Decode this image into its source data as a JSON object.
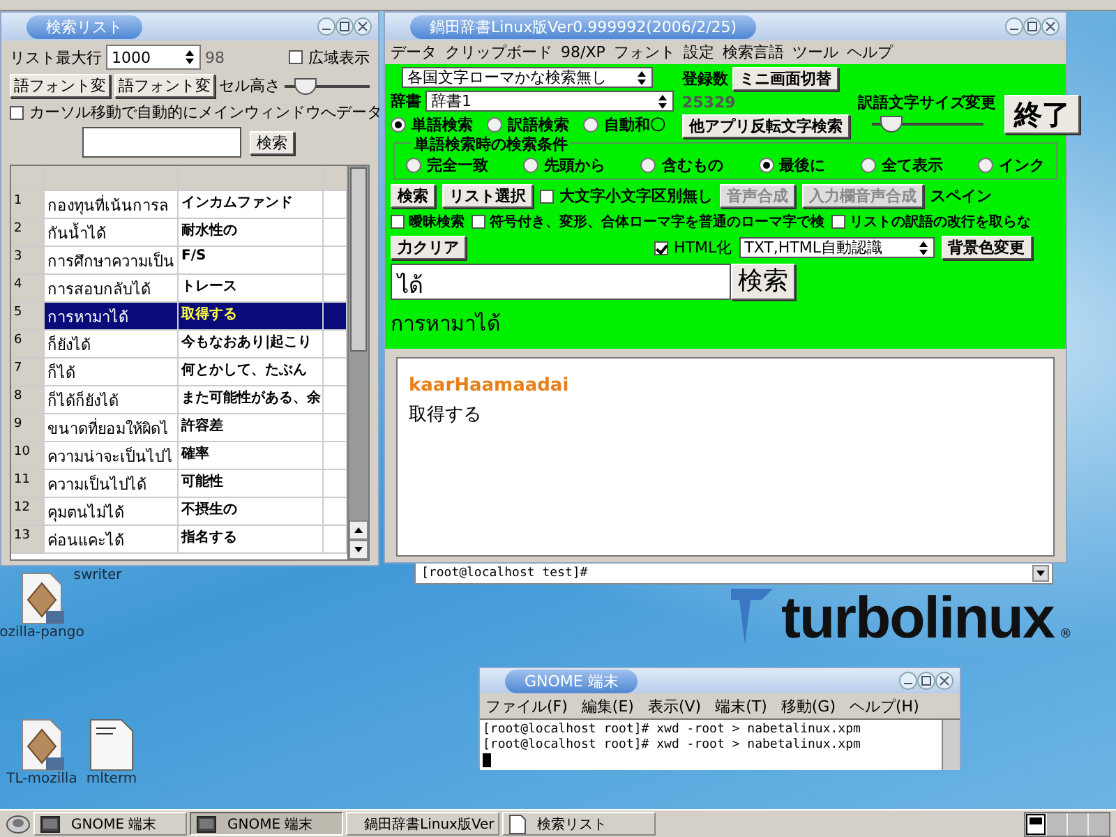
{
  "list_window": {
    "title": "検索リスト",
    "max_rows": {
      "label": "リスト最大行",
      "value": "1000"
    },
    "row_count": "98",
    "wide_display": {
      "label": "広域表示",
      "checked": false
    },
    "font_buttons": [
      "語フォント変",
      "語フォント変"
    ],
    "cell_height": {
      "label": "セル高さ",
      "level": 0.12
    },
    "auto_send": {
      "label": "カーソル移動で自動的にメインウィンドウへデータ",
      "checked": false
    },
    "search_button": "検索",
    "rows": [
      {
        "number": "1",
        "thai": "กองทุนที่เน้นการล",
        "japanese": "インカムファンド",
        "selected": false
      },
      {
        "number": "2",
        "thai": "กันน้ำได้",
        "japanese": "耐水性の",
        "selected": false
      },
      {
        "number": "3",
        "thai": "การศึกษาความเป็น",
        "japanese": "F/S",
        "selected": false
      },
      {
        "number": "4",
        "thai": "การสอบกลับได้",
        "japanese": "トレース",
        "selected": false
      },
      {
        "number": "5",
        "thai": "การหามาได้",
        "japanese": "取得する",
        "selected": true
      },
      {
        "number": "6",
        "thai": "ก็ยังได้",
        "japanese": "今もなおあり|起こり",
        "selected": false
      },
      {
        "number": "7",
        "thai": "ก็ได้",
        "japanese": "何とかして、たぶん",
        "selected": false
      },
      {
        "number": "8",
        "thai": "ก็ได้ก็ยังได้",
        "japanese": "また可能性がある、余",
        "selected": false
      },
      {
        "number": "9",
        "thai": "ขนาดที่ยอมให้ผิดไ",
        "japanese": "許容差",
        "selected": false
      },
      {
        "number": "10",
        "thai": "ความน่าจะเป็นไปไ",
        "japanese": "確率",
        "selected": false
      },
      {
        "number": "11",
        "thai": "ความเป็นไปได้",
        "japanese": "可能性",
        "selected": false
      },
      {
        "number": "12",
        "thai": "คุมตนไม่ได้",
        "japanese": "不摂生の",
        "selected": false
      },
      {
        "number": "13",
        "thai": "ค่อนแคะได้",
        "japanese": "指名する",
        "selected": false
      }
    ]
  },
  "main_window": {
    "title": "鍋田辞書Linux版Ver0.999992(2006/2/25)",
    "menu": [
      "データ",
      "クリップボード",
      "98/XP",
      "フォント",
      "設定",
      "検索言語",
      "ツール",
      "ヘルプ"
    ],
    "romaji_select": "各国文字ローマかな検索無し",
    "dictionary": {
      "label": "辞書",
      "value": "辞書1"
    },
    "registered": {
      "label": "登録数",
      "count": "25329"
    },
    "mini_button": "ミニ画面切替",
    "reverse_button": "他アプリ反転文字検索",
    "font_size": {
      "label": "訳語文字サイズ変更",
      "level": 0.08
    },
    "quit_button": "終了",
    "search_modes": [
      {
        "label": "単語検索",
        "selected": true
      },
      {
        "label": "訳語検索",
        "selected": false
      },
      {
        "label": "自動和〇",
        "selected": false
      }
    ],
    "conditions": {
      "title": "単語検索時の検索条件",
      "options": [
        {
          "label": "完全一致",
          "selected": false
        },
        {
          "label": "先頭から",
          "selected": false
        },
        {
          "label": "含むもの",
          "selected": false
        },
        {
          "label": "最後に",
          "selected": true
        },
        {
          "label": "全て表示",
          "selected": false
        },
        {
          "label": "インク",
          "selected": false
        }
      ]
    },
    "action_row": [
      {
        "kind": "button",
        "label": "検索",
        "disabled": false
      },
      {
        "kind": "button",
        "label": "リスト選択",
        "disabled": false
      },
      {
        "kind": "checkbox",
        "label": "大文字小文字区別無し",
        "checked": false
      },
      {
        "kind": "button",
        "label": "音声合成",
        "disabled": true
      },
      {
        "kind": "button",
        "label": "入力欄音声合成",
        "disabled": true
      },
      {
        "kind": "text",
        "label": "スペイン"
      }
    ],
    "option_checks": [
      {
        "label": "曖昧検索",
        "checked": false
      },
      {
        "label": "符号付き、変形、合体ローマ字を普通のローマ字で検",
        "checked": false
      },
      {
        "label": "リストの訳語の改行を取らな",
        "checked": false
      }
    ],
    "clear_button": "力クリア",
    "html": {
      "label": "HTML化",
      "checked": true
    },
    "format_select": "TXT,HTML自動認識",
    "bg_button": "背景色変更",
    "query": "ได้",
    "query_button": "検索",
    "result_heading": "การหามาได้",
    "result": {
      "reading": "kaarHaamaadai",
      "meaning": "取得する"
    }
  },
  "back_terminal": {
    "line": "[root@localhost test]#"
  },
  "desktop_icons": [
    {
      "label": "swriter",
      "kind": "hidden"
    },
    {
      "label": "ozilla-pango",
      "kind": "package"
    },
    {
      "label": "TL-mozilla",
      "kind": "package"
    },
    {
      "label": "mlterm",
      "kind": "script"
    }
  ],
  "logo": {
    "text": "turbolinux",
    "mark": "®"
  },
  "terminal": {
    "title": "GNOME 端末",
    "menu": [
      "ファイル(F)",
      "編集(E)",
      "表示(V)",
      "端末(T)",
      "移動(G)",
      "ヘルプ(H)"
    ],
    "lines": [
      "[root@localhost root]# xwd -root > nabetalinux.xpm",
      "[root@localhost root]# xwd -root > nabetalinux.xpm"
    ]
  },
  "taskbar": {
    "items": [
      {
        "label": "GNOME 端末",
        "kind": "terminal",
        "selected": false
      },
      {
        "label": "GNOME 端末",
        "kind": "terminal",
        "selected": true
      },
      {
        "label": "鍋田辞書Linux版Ver",
        "kind": "window",
        "selected": false
      },
      {
        "label": "検索リスト",
        "kind": "window",
        "selected": false
      }
    ]
  }
}
